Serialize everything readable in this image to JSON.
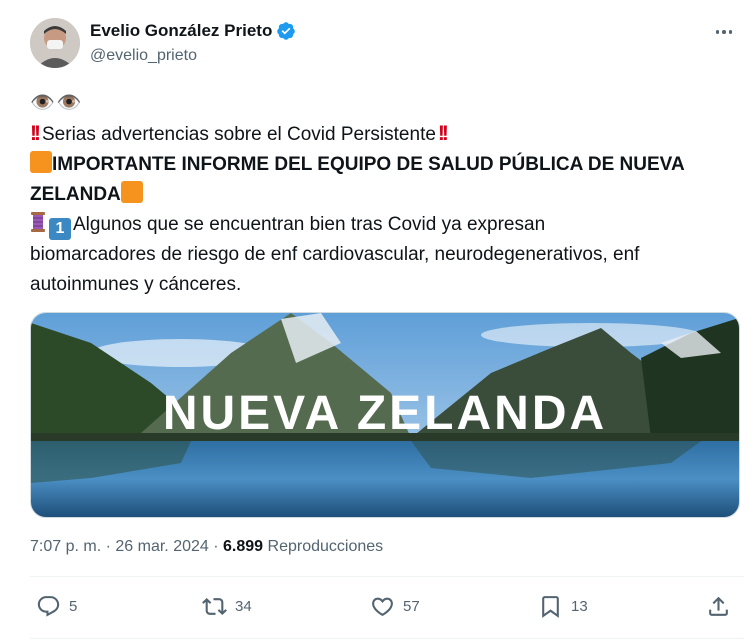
{
  "author": {
    "name": "Evelio González Prieto",
    "handle": "@evelio_prieto"
  },
  "post": {
    "line1": "👁️👁️",
    "line2_text": "Serias advertencias sobre el Covid Persistente",
    "line3_text": "IMPORTANTE INFORME DEL EQUIPO DE SALUD PÚBLICA DE NUEVA",
    "line4_text": "ZELANDA",
    "line5_text": "Algunos que se encuentran bien tras Covid ya expresan",
    "line6_text": "biomarcadores de riesgo de enf cardiovascular, neurodegenerativos, enf",
    "line7_text": "autoinmunes y cánceres.",
    "keycap": "1"
  },
  "media": {
    "overlay_text": "NUEVA ZELANDA"
  },
  "meta": {
    "time": "7:07 p. m.",
    "sep": "·",
    "date": "26 mar. 2024",
    "views": "6.899",
    "views_label": "Reproducciones"
  },
  "actions": {
    "replies": "5",
    "reposts": "34",
    "likes": "57",
    "bookmarks": "13"
  },
  "colors": {
    "verified": "#1d9bf0",
    "muted": "#536471",
    "emoji_orange": "#f6931e",
    "emoji_red": "#d0021b"
  }
}
